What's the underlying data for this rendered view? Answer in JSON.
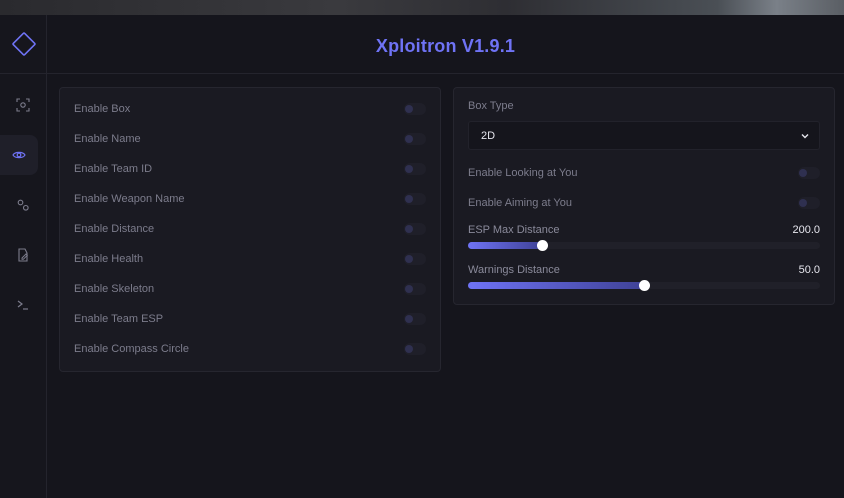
{
  "app": {
    "title": "Xploitron V1.9.1",
    "accent": "#6f73f5"
  },
  "sidebar": {
    "logo_icon": "diamond-icon",
    "items": [
      {
        "icon": "crosshair-icon",
        "active": false
      },
      {
        "icon": "eye-icon",
        "active": true
      },
      {
        "icon": "gears-icon",
        "active": false
      },
      {
        "icon": "file-edit-icon",
        "active": false
      },
      {
        "icon": "terminal-icon",
        "active": false
      }
    ]
  },
  "left_panel": {
    "toggles": [
      {
        "label": "Enable Box",
        "on": false
      },
      {
        "label": "Enable Name",
        "on": false
      },
      {
        "label": "Enable Team ID",
        "on": false
      },
      {
        "label": "Enable Weapon Name",
        "on": false
      },
      {
        "label": "Enable Distance",
        "on": false
      },
      {
        "label": "Enable Health",
        "on": false
      },
      {
        "label": "Enable Skeleton",
        "on": false
      },
      {
        "label": "Enable Team ESP",
        "on": false
      },
      {
        "label": "Enable Compass Circle",
        "on": false
      }
    ]
  },
  "right_panel": {
    "box_type_label": "Box Type",
    "box_type_value": "2D",
    "toggles": [
      {
        "label": "Enable Looking at You",
        "on": false
      },
      {
        "label": "Enable Aiming at You",
        "on": false
      }
    ],
    "sliders": [
      {
        "label": "ESP Max Distance",
        "value": "200.0",
        "fraction": 0.21
      },
      {
        "label": "Warnings Distance",
        "value": "50.0",
        "fraction": 0.5
      }
    ]
  }
}
